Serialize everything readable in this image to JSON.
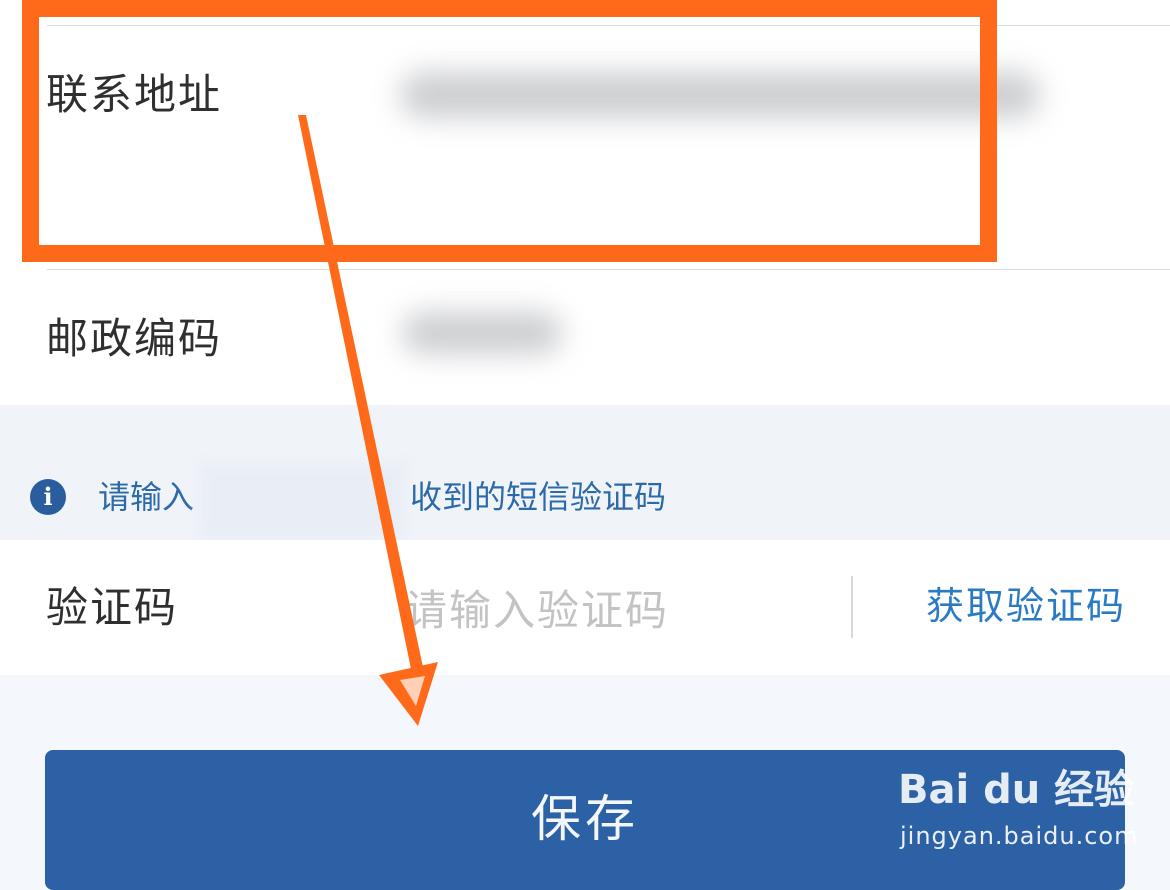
{
  "address_row": {
    "label": "联系地址"
  },
  "postcode_row": {
    "label": "邮政编码"
  },
  "notice": {
    "icon": "info-icon",
    "text_before": "请输入",
    "text_after": "收到的短信验证码"
  },
  "code_row": {
    "label": "验证码",
    "placeholder": "请输入验证码",
    "get_code_label": "获取验证码"
  },
  "save_button": {
    "label": "保存"
  },
  "watermark": {
    "logo_text": "Bai du 经验",
    "url": "jingyan.baidu.com"
  },
  "colors": {
    "accent_orange": "#ff6a1a",
    "primary_blue": "#2c62a5",
    "link_blue": "#2b7bc4",
    "notice_text_blue": "#2d6aa8"
  }
}
